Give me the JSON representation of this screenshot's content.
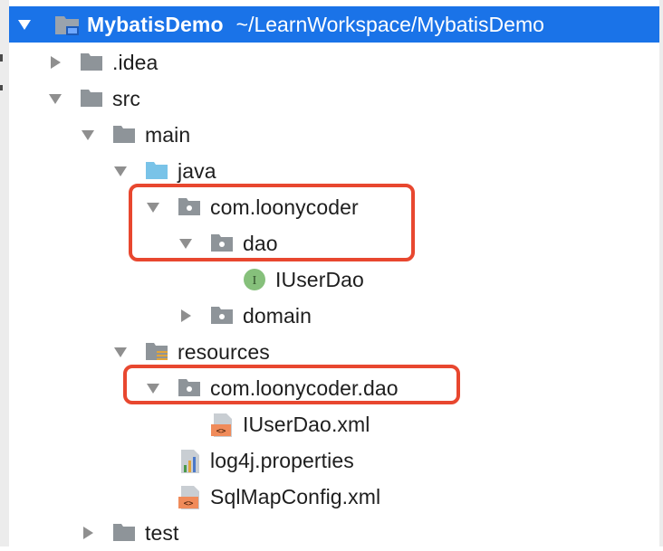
{
  "project": {
    "name": "MybatisDemo",
    "path": "~/LearnWorkspace/MybatisDemo"
  },
  "tree": {
    "idea": ".idea",
    "src": "src",
    "main": "main",
    "java": "java",
    "com_loonycoder": "com.loonycoder",
    "dao": "dao",
    "iuserdao": "IUserDao",
    "domain": "domain",
    "resources": "resources",
    "com_loonycoder_dao": "com.loonycoder.dao",
    "iuserdao_xml": "IUserDao.xml",
    "log4j": "log4j.properties",
    "sqlmapconfig": "SqlMapConfig.xml",
    "test": "test"
  },
  "icons": {
    "interface_badge": "I",
    "xml_badge": "<>"
  },
  "colors": {
    "selection": "#1a73e8",
    "highlight_box": "#e8472f",
    "folder": "#8e9499",
    "source_folder": "#79c3e8",
    "interface": "#86c07b",
    "xml": "#f08b5a"
  }
}
